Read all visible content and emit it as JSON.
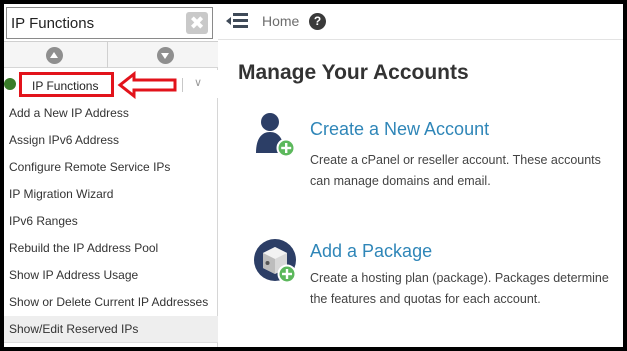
{
  "search": {
    "value": "IP Functions",
    "clear_glyph": "✖"
  },
  "sidebar": {
    "category": {
      "label": "IP Functions",
      "chevron": "∨"
    },
    "items": [
      {
        "label": "Add a New IP Address"
      },
      {
        "label": "Assign IPv6 Address"
      },
      {
        "label": "Configure Remote Service IPs"
      },
      {
        "label": "IP Migration Wizard"
      },
      {
        "label": "IPv6 Ranges"
      },
      {
        "label": "Rebuild the IP Address Pool"
      },
      {
        "label": "Show IP Address Usage"
      },
      {
        "label": "Show or Delete Current IP Addresses"
      },
      {
        "label": "Show/Edit Reserved IPs"
      }
    ]
  },
  "topbar": {
    "home_label": "Home",
    "help_glyph": "?"
  },
  "main": {
    "title": "Manage Your Accounts",
    "features": [
      {
        "title": "Create a New Account",
        "description": "Create a cPanel or reseller account. These accounts can manage domains and email.",
        "icon": "user-add-icon"
      },
      {
        "title": "Add a Package",
        "description": "Create a hosting plan (package). Packages determine the features and quotas for each account.",
        "icon": "package-add-icon"
      }
    ]
  },
  "colors": {
    "highlight_red": "#e2131b",
    "link_blue": "#2f86b8",
    "icon_navy": "#2c3e66",
    "badge_green": "#5cb85c"
  }
}
